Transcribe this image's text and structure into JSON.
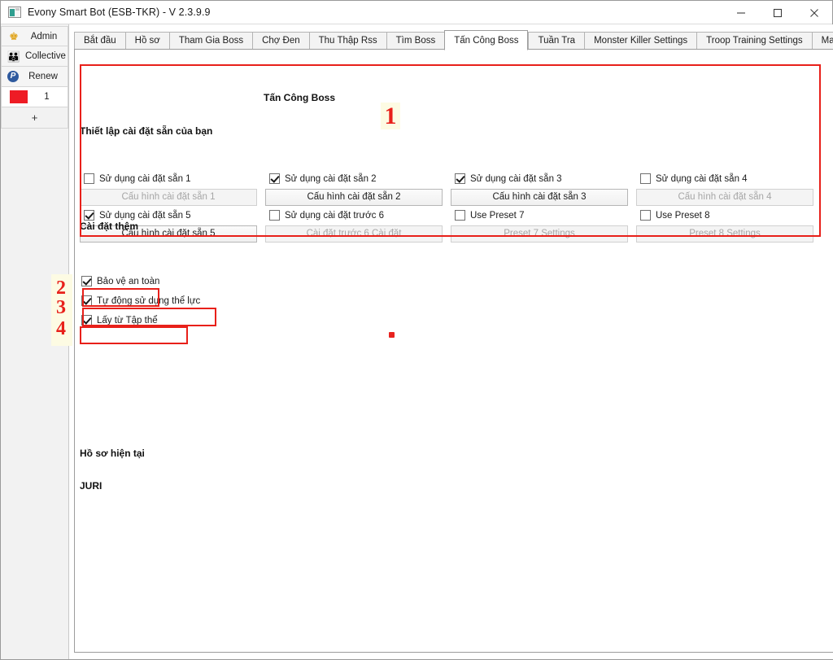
{
  "window": {
    "title": "Evony Smart Bot (ESB-TKR) - V 2.3.9.9",
    "app_icon": "app-window-icon",
    "minimize_glyph": "minimize-icon",
    "maximize_glyph": "maximize-icon",
    "close_glyph": "close-icon"
  },
  "sidebar": {
    "items": [
      {
        "label": "Admin",
        "icon": "crown-icon",
        "glyph": "♛"
      },
      {
        "label": "Collective",
        "icon": "people-icon",
        "glyph": "⚇"
      },
      {
        "label": "Renew",
        "icon": "paypal-icon",
        "glyph": "P"
      },
      {
        "label": "1",
        "icon": "red-swatch-icon",
        "glyph": ""
      }
    ],
    "add_button": "+"
  },
  "tabs": [
    {
      "label": "Bắt đầu",
      "selected": false
    },
    {
      "label": "Hồ sơ",
      "selected": false
    },
    {
      "label": "Tham Gia Boss",
      "selected": false
    },
    {
      "label": "Chợ Đen",
      "selected": false
    },
    {
      "label": "Thu Thập Rss",
      "selected": false
    },
    {
      "label": "Tìm Boss",
      "selected": false
    },
    {
      "label": "Tấn Công Boss",
      "selected": true
    },
    {
      "label": "Tuần Tra",
      "selected": false
    },
    {
      "label": "Monster Killer Settings",
      "selected": false
    },
    {
      "label": "Troop Training Settings",
      "selected": false
    },
    {
      "label": "Mail Sender Settings",
      "selected": false
    }
  ],
  "tab_scroll": {
    "left": "◄",
    "right": "►"
  },
  "main": {
    "panel_title": "Tấn Công Boss",
    "presets_heading": "Thiết lập cài đặt sẵn của bạn",
    "extra_heading": "Cài đặt thêm",
    "current_profile_heading": "Hồ sơ hiện tại",
    "current_profile_value": "JURI",
    "presets": [
      {
        "checkbox_label": "Sử dụng cài đặt sẵn 1",
        "button_label": "Cấu hình cài đặt sẵn 1",
        "checked": false,
        "enabled": false
      },
      {
        "checkbox_label": "Sử dụng cài đặt sẵn 2",
        "button_label": "Cấu hình cài đặt sẵn 2",
        "checked": true,
        "enabled": true
      },
      {
        "checkbox_label": "Sử dụng cài đặt sẵn 3",
        "button_label": "Cấu hình cài đặt sẵn 3",
        "checked": true,
        "enabled": true
      },
      {
        "checkbox_label": "Sử dụng cài đặt sẵn 4",
        "button_label": "Cấu hình cài đặt sẵn 4",
        "checked": false,
        "enabled": false
      },
      {
        "checkbox_label": "Sử dụng cài đặt sẵn 5",
        "button_label": "Cấu hình cài đặt sẵn 5",
        "checked": true,
        "enabled": true
      },
      {
        "checkbox_label": "Sử dụng cài đặt trước 6",
        "button_label": "Cài đặt trước 6 Cài đặt",
        "checked": false,
        "enabled": false
      },
      {
        "checkbox_label": "Use Preset 7",
        "button_label": "Preset 7 Settings",
        "checked": false,
        "enabled": false
      },
      {
        "checkbox_label": "Use Preset 8",
        "button_label": "Preset 8 Settings",
        "checked": false,
        "enabled": false
      }
    ],
    "extra_options": [
      {
        "label": "Bảo vệ an toàn",
        "checked": true
      },
      {
        "label": "Tự động sử dụng thể lực",
        "checked": true
      },
      {
        "label": "Lấy từ Tập thể",
        "checked": true
      }
    ]
  },
  "annotations": [
    {
      "number": "1"
    },
    {
      "number": "2"
    },
    {
      "number": "3"
    },
    {
      "number": "4"
    }
  ],
  "colors": {
    "annotation_red": "#e8201a",
    "annotation_highlight": "#fdfbe3",
    "swatch_red": "#ee1c25",
    "marker_dot": "#e8231f"
  }
}
